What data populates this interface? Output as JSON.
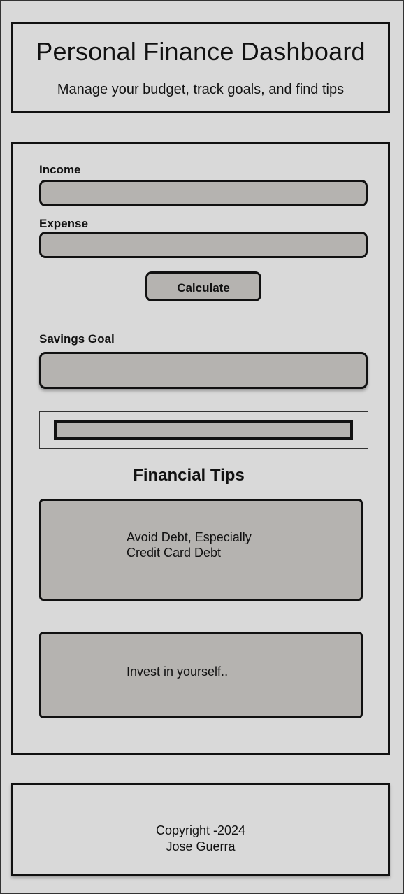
{
  "header": {
    "title": "Personal Finance Dashboard",
    "subtitle": "Manage your budget, track goals, and find tips"
  },
  "form": {
    "income_label": "Income",
    "income_value": "",
    "expense_label": "Expense",
    "expense_value": "",
    "calculate_label": "Calculate",
    "savings_goal_label": "Savings Goal",
    "savings_goal_value": ""
  },
  "progress": {
    "fraction": 1.0
  },
  "tips": {
    "heading": "Financial Tips",
    "items": [
      {
        "line1": "Avoid Debt, Especially",
        "line2": "Credit Card Debt"
      },
      {
        "line1": "Invest in yourself..",
        "line2": ""
      }
    ]
  },
  "footer": {
    "line1": "Copyright -2024",
    "line2": "Jose Guerra"
  },
  "colors": {
    "background": "#d9d9d9",
    "field_fill": "#b5b3b0",
    "border": "#111111"
  }
}
